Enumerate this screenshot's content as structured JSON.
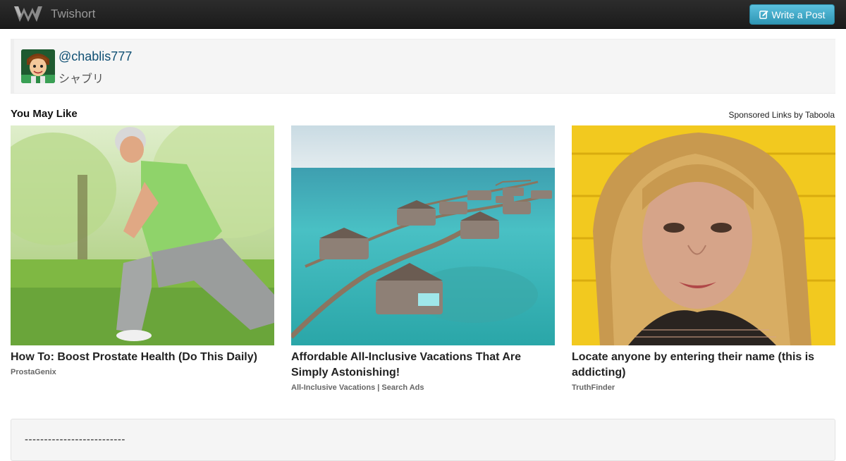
{
  "navbar": {
    "brand_name": "Twishort",
    "write_label": "Write a Post",
    "logo_icon": "twishort-logo-icon",
    "write_icon": "edit-icon"
  },
  "profile": {
    "username": "@chablis777",
    "display_name": "シャブリ"
  },
  "recommendations": {
    "title": "You May Like",
    "sponsored_label": "Sponsored Links by Taboola",
    "items": [
      {
        "headline": "How To: Boost Prostate Health (Do This Daily)",
        "source": "ProstaGenix"
      },
      {
        "headline": "Affordable All-Inclusive Vacations That Are Simply Astonishing!",
        "source": "All-Inclusive Vacations | Search Ads"
      },
      {
        "headline": "Locate anyone by entering their name (this is addicting)",
        "source": "TruthFinder"
      }
    ]
  },
  "post": {
    "text": "--------------------------"
  },
  "colors": {
    "accent": "#5bc0de",
    "link": "#0e4f73",
    "navbar": "#1b1b1b"
  }
}
